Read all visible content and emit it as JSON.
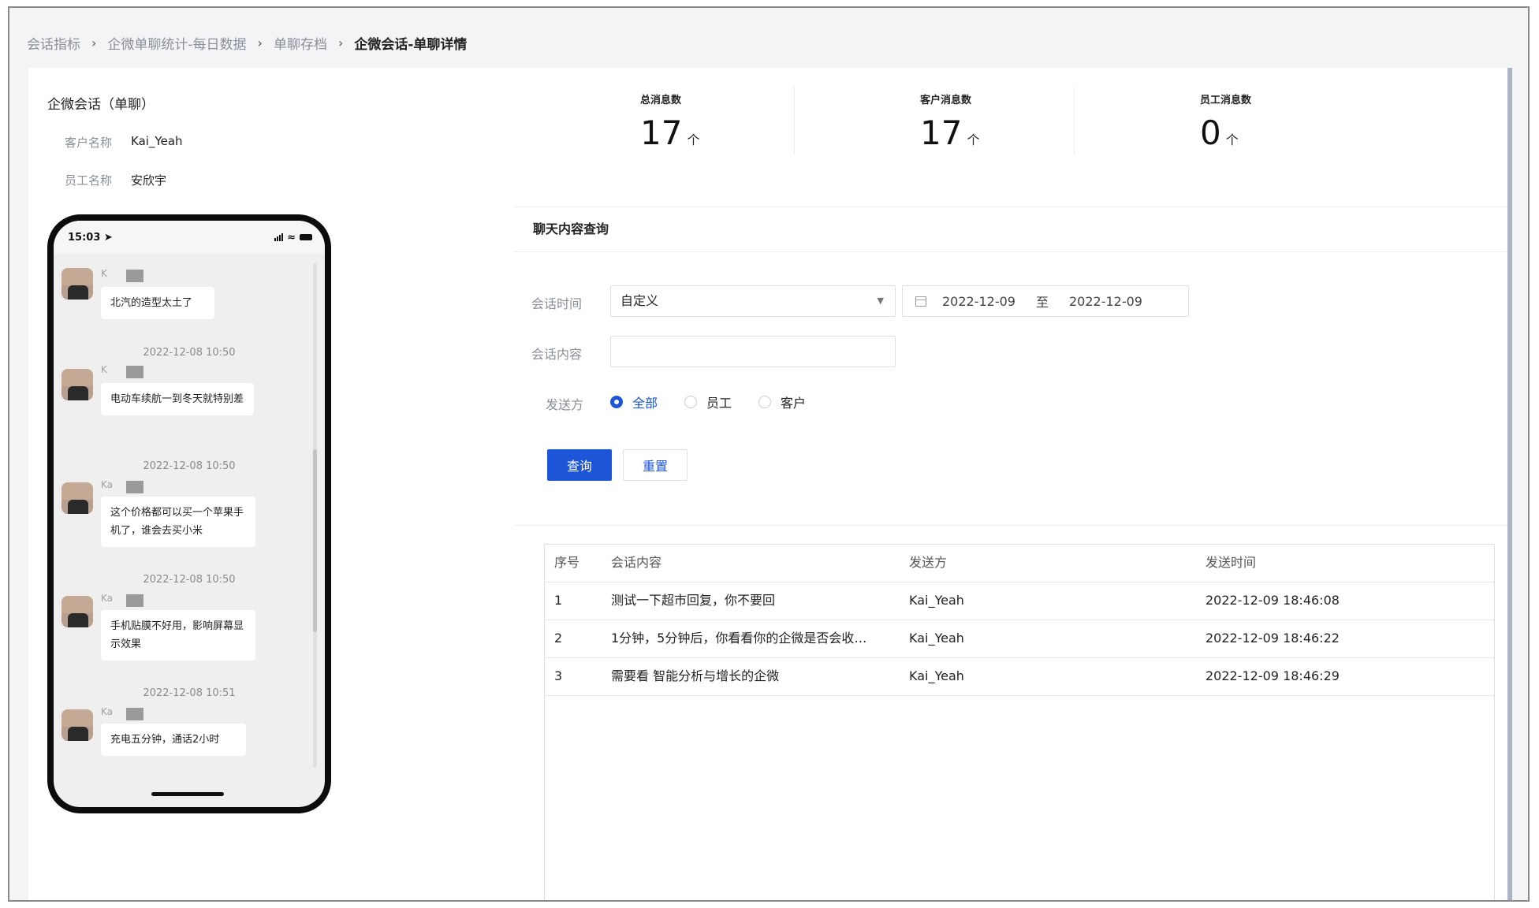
{
  "breadcrumb": {
    "items": [
      "会话指标",
      "企微单聊统计-每日数据",
      "单聊存档"
    ],
    "current": "企微会话-单聊详情"
  },
  "left": {
    "title": "企微会话（单聊）",
    "customer_label": "客户名称",
    "customer_value": "Kai_Yeah",
    "staff_label": "员工名称",
    "staff_value": "安欣宇"
  },
  "phone": {
    "time": "15:03",
    "messages": [
      {
        "timestamp": "",
        "nick": "K",
        "text": "北汽的造型太土了"
      },
      {
        "timestamp": "2022-12-08 10:50",
        "nick": "K",
        "text": "电动车续航一到冬天就特别差"
      },
      {
        "timestamp": "2022-12-08 10:50",
        "nick": "Ka",
        "text": "这个价格都可以买一个苹果手机了，谁会去买小米"
      },
      {
        "timestamp": "2022-12-08 10:50",
        "nick": "Ka",
        "text": "手机贴膜不好用，影响屏幕显示效果"
      },
      {
        "timestamp": "2022-12-08 10:51",
        "nick": "Ka",
        "text": "充电五分钟，通话2小时"
      }
    ]
  },
  "stats": [
    {
      "label": "总消息数",
      "value": "17",
      "unit": "个"
    },
    {
      "label": "客户消息数",
      "value": "17",
      "unit": "个"
    },
    {
      "label": "员工消息数",
      "value": "0",
      "unit": "个"
    }
  ],
  "query": {
    "section_title": "聊天内容查询",
    "time_label": "会话时间",
    "time_select": "自定义",
    "date_start": "2022-12-09",
    "date_sep": "至",
    "date_end": "2022-12-09",
    "content_label": "会话内容",
    "content_value": "",
    "sender_label": "发送方",
    "sender_options": [
      "全部",
      "员工",
      "客户"
    ],
    "sender_selected": "全部",
    "submit_label": "查询",
    "reset_label": "重置"
  },
  "table": {
    "headers": [
      "序号",
      "会话内容",
      "发送方",
      "发送时间"
    ],
    "rows": [
      [
        "1",
        "测试一下超市回复，你不要回",
        "Kai_Yeah",
        "2022-12-09 18:46:08"
      ],
      [
        "2",
        "1分钟，5分钟后，你看看你的企微是否会收…",
        "Kai_Yeah",
        "2022-12-09 18:46:22"
      ],
      [
        "3",
        "需要看 智能分析与增长的企微",
        "Kai_Yeah",
        "2022-12-09 18:46:29"
      ]
    ]
  },
  "colors": {
    "primary": "#1d55d9",
    "page_bg": "#f3f4f6",
    "border": "#dcdfe4"
  }
}
